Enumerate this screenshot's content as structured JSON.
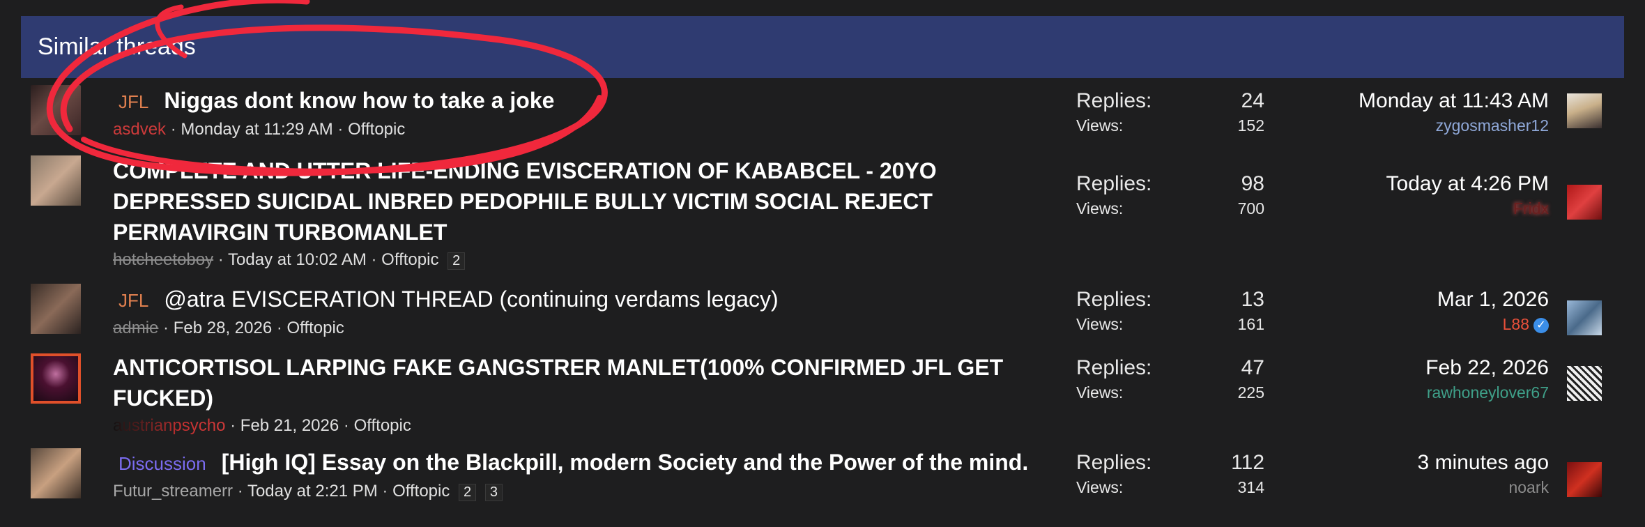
{
  "header": {
    "title": "Similar threads"
  },
  "threads": [
    {
      "prefix": "JFL",
      "title": "Niggas dont know how to take a joke",
      "author": "asdvek",
      "started": "Monday at 11:29 AM",
      "forum": "Offtopic",
      "replies_label": "Replies:",
      "replies": "24",
      "views_label": "Views:",
      "views": "152",
      "last_date": "Monday at 11:43 AM",
      "last_user": "zygosmasher12"
    },
    {
      "title_line1": "COMPLETE AND UTTER LIFE-ENDING EVISCERATION OF KABABCEL - 20YO",
      "title_line2": "DEPRESSED SUICIDAL INBRED PEDOPHILE BULLY VICTIM SOCIAL REJECT",
      "title_line3": "PERMAVIRGIN TURBOMANLET",
      "author": "hotcheetoboy",
      "started": "Today at 10:02 AM",
      "forum": "Offtopic",
      "pages": [
        "2"
      ],
      "replies_label": "Replies:",
      "replies": "98",
      "views_label": "Views:",
      "views": "700",
      "last_date": "Today at 4:26 PM",
      "last_user": "Fridx"
    },
    {
      "prefix": "JFL",
      "title": "@atra EVISCERATION THREAD (continuing verdams legacy)",
      "author": "admie",
      "started": "Feb 28, 2026",
      "forum": "Offtopic",
      "replies_label": "Replies:",
      "replies": "13",
      "views_label": "Views:",
      "views": "161",
      "last_date": "Mar 1, 2026",
      "last_user": "L88"
    },
    {
      "title_line1": "ANTICORTISOL LARPING FAKE GANGSTRER MANLET(100% CONFIRMED JFL GET",
      "title_line2": "FUCKED)",
      "author": "austrianpsycho",
      "started": "Feb 21, 2026",
      "forum": "Offtopic",
      "replies_label": "Replies:",
      "replies": "47",
      "views_label": "Views:",
      "views": "225",
      "last_date": "Feb 22, 2026",
      "last_user": "rawhoneylover67"
    },
    {
      "prefix": "Discussion",
      "title": "[High IQ] Essay on the Blackpill, modern Society and the Power of the mind.",
      "author": "Futur_streamerr",
      "started": "Today at 2:21 PM",
      "forum": "Offtopic",
      "pages": [
        "2",
        "3"
      ],
      "replies_label": "Replies:",
      "replies": "112",
      "views_label": "Views:",
      "views": "314",
      "last_date": "3 minutes ago",
      "last_user": "noark"
    }
  ],
  "colors": {
    "header_bg": "#2f3b71",
    "page_bg": "#1e1e1f",
    "annotation": "#f0283c",
    "prefix_jfl": "#e0804f",
    "prefix_discussion": "#7b6cf0",
    "user_zygosmasher12": "#8fa8d8",
    "user_fridx": "#6a1f1f",
    "user_l88": "#e8503a",
    "user_rawhoneylover67": "#3fa089",
    "user_noark": "#8c8c8c"
  },
  "icons": {
    "verified": "verified-check-icon"
  }
}
